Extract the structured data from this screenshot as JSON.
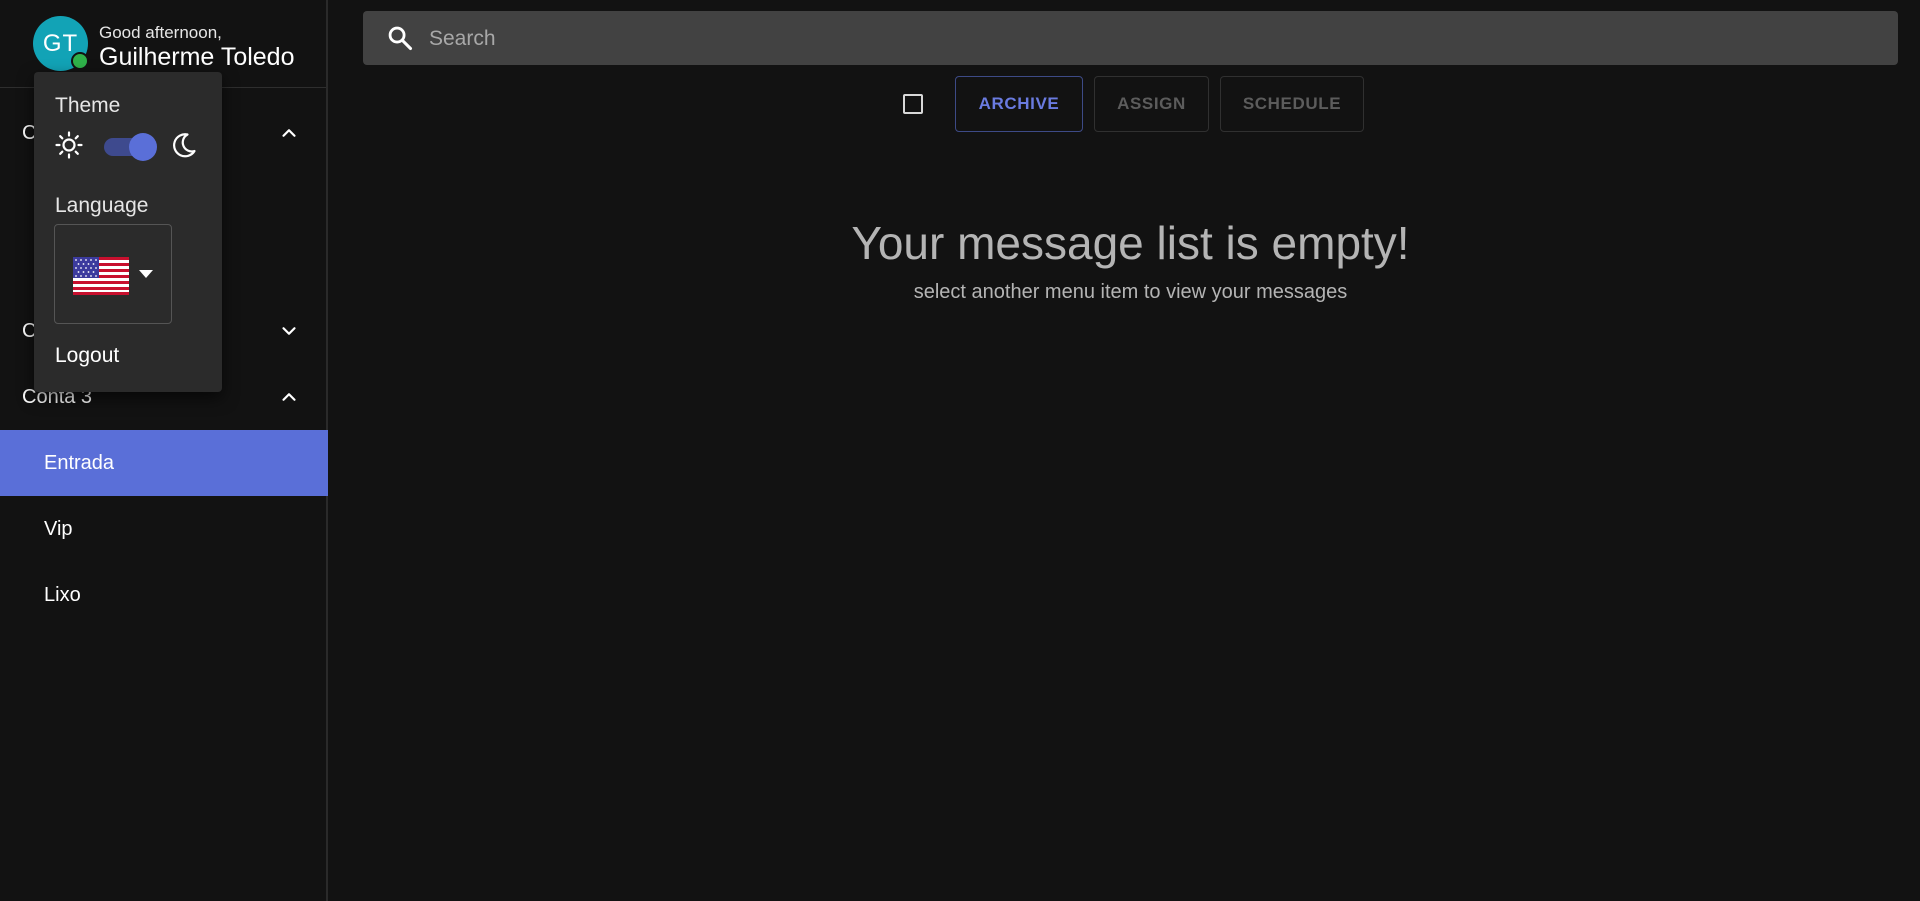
{
  "user": {
    "initials": "GT",
    "greeting": "Good afternoon,",
    "name": "Guilherme Toledo",
    "status": "online"
  },
  "popover": {
    "theme_label": "Theme",
    "theme_mode": "dark",
    "language_label": "Language",
    "language_selected": "en-US",
    "logout_label": "Logout"
  },
  "sidebar": {
    "accounts": [
      {
        "label": "C",
        "expanded": true,
        "chevron": "chevron-up-icon"
      },
      {
        "label": "C",
        "expanded": false,
        "chevron": "chevron-down-icon"
      },
      {
        "label": "Conta 3",
        "expanded": true,
        "chevron": "chevron-up-icon"
      }
    ],
    "folders": [
      {
        "label": "Entrada",
        "active": true
      },
      {
        "label": "Vip",
        "active": false
      },
      {
        "label": "Lixo",
        "active": false
      }
    ]
  },
  "search": {
    "placeholder": "Search",
    "value": ""
  },
  "toolbar": {
    "archive_label": "ARCHIVE",
    "assign_label": "ASSIGN",
    "schedule_label": "SCHEDULE"
  },
  "empty_state": {
    "title": "Your message list is empty!",
    "subtitle": "select another menu item to view your messages"
  },
  "colors": {
    "accent": "#5a6fd8",
    "background": "#121212",
    "avatar": "#12a3b6",
    "online": "#2fb24a"
  }
}
